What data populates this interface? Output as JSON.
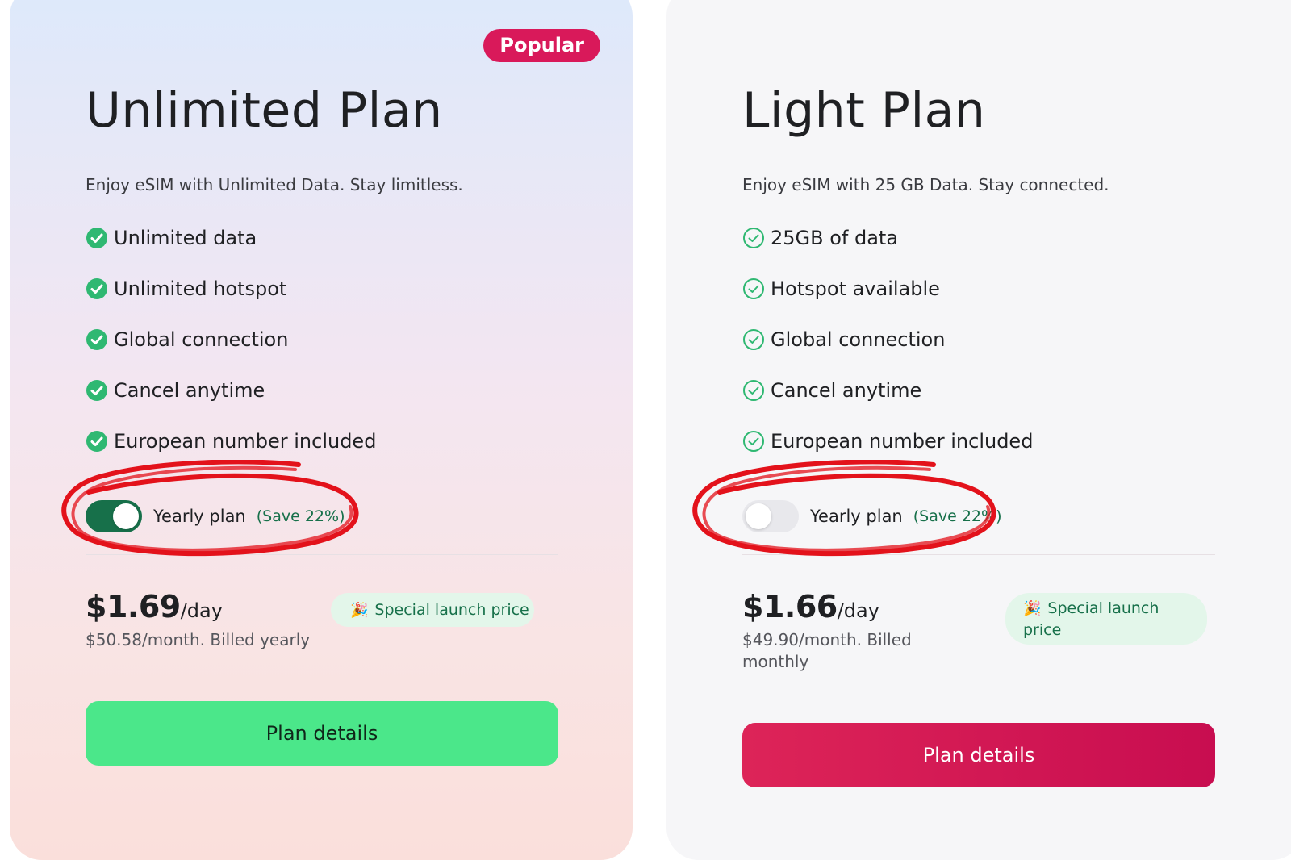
{
  "plans": [
    {
      "badge": "Popular",
      "title": "Unlimited Plan",
      "subtitle": "Enjoy eSIM with Unlimited Data. Stay limitless.",
      "features": [
        "Unlimited data",
        "Unlimited hotspot",
        "Global connection",
        "Cancel anytime",
        "European number included"
      ],
      "check_style": "filled",
      "toggle": {
        "label": "Yearly plan",
        "save": "(Save 22%)",
        "on": true
      },
      "price": {
        "amount": "$1.69",
        "unit": "/day",
        "billing": "$50.58/month. Billed yearly"
      },
      "launch_badge": {
        "emoji": "🎉",
        "text": "Special launch price"
      },
      "cta": {
        "label": "Plan details",
        "color": "#4be78a"
      }
    },
    {
      "title": "Light Plan",
      "subtitle": "Enjoy eSIM with 25 GB Data. Stay connected.",
      "features": [
        "25GB of data",
        "Hotspot available",
        "Global connection",
        "Cancel anytime",
        "European number included"
      ],
      "check_style": "outline",
      "toggle": {
        "label": "Yearly plan",
        "save": "(Save 22%)",
        "on": false
      },
      "price": {
        "amount": "$1.66",
        "unit": "/day",
        "billing": "$49.90/month. Billed monthly"
      },
      "launch_badge": {
        "emoji": "🎉",
        "text": "Special launch price"
      },
      "cta": {
        "label": "Plan details",
        "color": "#d9195a"
      }
    }
  ],
  "colors": {
    "accent_green": "#17704a",
    "check_green": "#2fb872",
    "badge_red": "#d9195a",
    "annotation_red": "#e3121b"
  },
  "icons": {
    "check": "check-circle-icon",
    "check_outline": "check-circle-outline-icon",
    "party": "party-popper-icon"
  }
}
